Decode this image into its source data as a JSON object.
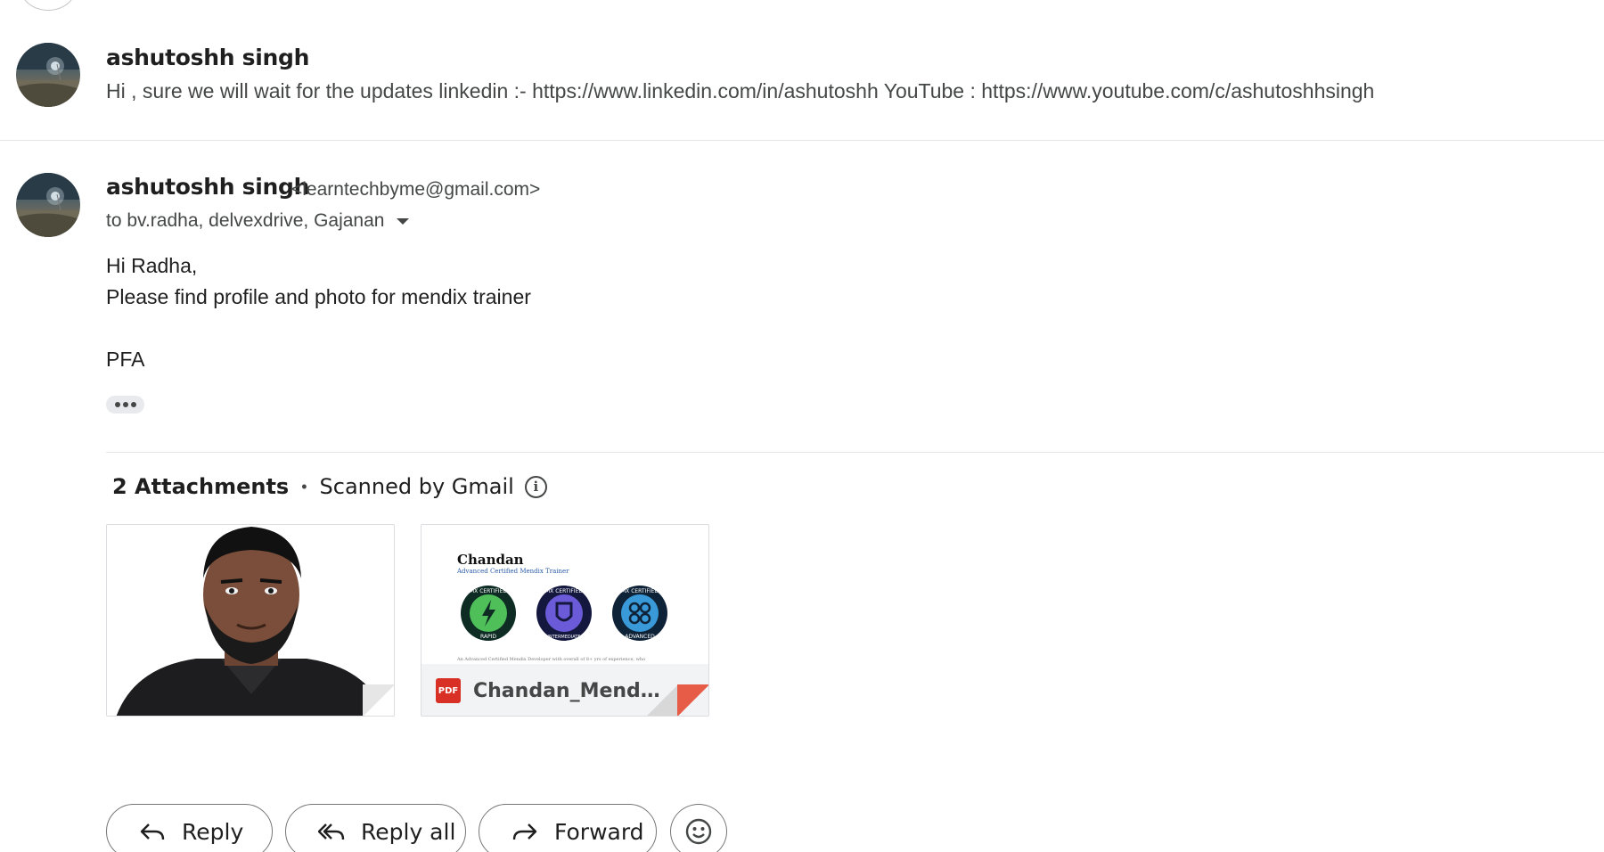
{
  "messages": {
    "collapsed": {
      "sender": "ashutoshh singh",
      "snippet": "Hi , sure we will wait for the updates linkedin :- https://www.linkedin.com/in/ashutoshh YouTube : https://www.youtube.com/c/ashutoshhsingh"
    },
    "expanded": {
      "sender": "ashutoshh singh",
      "email": "<learntechbyme@gmail.com>",
      "recipients": "to bv.radha, delvexdrive, Gajanan",
      "body": {
        "line1": "Hi Radha,",
        "line2": "Please find profile and photo for mendix trainer",
        "line3": "PFA"
      }
    }
  },
  "attachments": {
    "count_label": "2 Attachments",
    "scanned_label": "Scanned by Gmail",
    "items": [
      {
        "type": "image"
      },
      {
        "type": "pdf",
        "icon_label": "PDF",
        "filename": "Chandan_Mendix...",
        "preview": {
          "name": "Chandan",
          "subtitle": "Advanced Certified Mendix Trainer",
          "badges": [
            {
              "top": "MX CERTIFIED",
              "bottom": "RAPID",
              "color": "#3fa34d"
            },
            {
              "top": "MX CERTIFIED",
              "bottom": "INTERMEDIATE",
              "color": "#5b4bd1"
            },
            {
              "top": "MX CERTIFIED",
              "bottom": "ADVANCED",
              "color": "#2e86c9"
            }
          ],
          "footer": "An Advanced Certified Mendix Developer with overall of 8+ yrs of experience, who"
        }
      }
    ]
  },
  "actions": {
    "reply": "Reply",
    "reply_all": "Reply all",
    "forward": "Forward"
  }
}
